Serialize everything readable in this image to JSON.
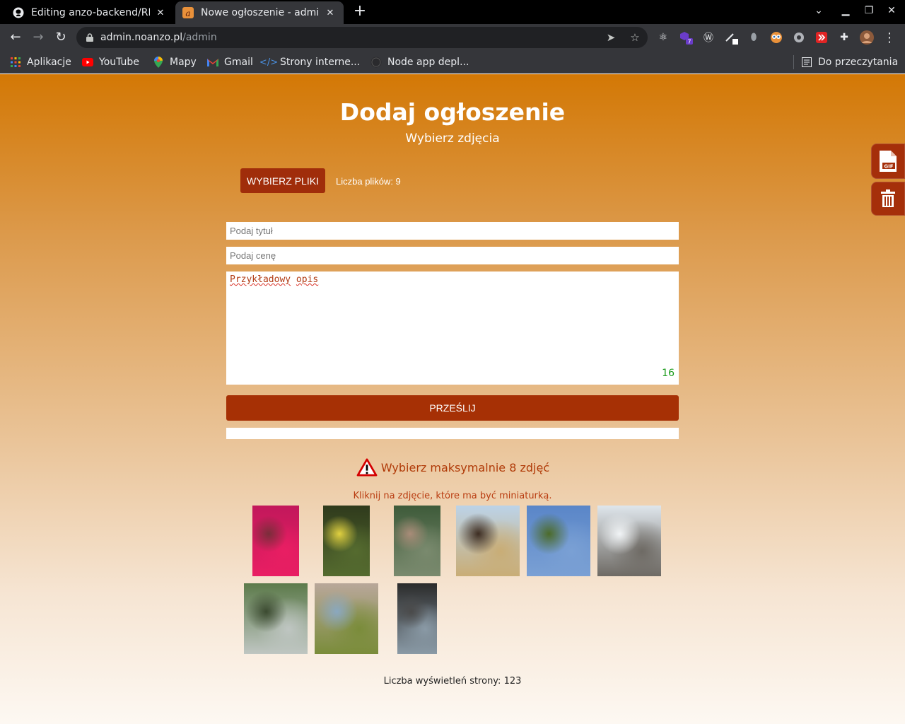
{
  "browser": {
    "tabs": [
      {
        "title": "Editing anzo-backend/RE",
        "active": false
      },
      {
        "title": "Nowe ogłoszenie - admin.",
        "active": true
      }
    ],
    "url_host": "admin.noanzo.pl",
    "url_path": "/admin",
    "extension_badge": "7",
    "bookmarks": [
      {
        "label": "Aplikacje",
        "icon": "apps-grid-icon"
      },
      {
        "label": "YouTube",
        "icon": "youtube-icon"
      },
      {
        "label": "Mapy",
        "icon": "maps-pin-icon"
      },
      {
        "label": "Gmail",
        "icon": "gmail-icon"
      },
      {
        "label": "Strony interne...",
        "icon": "code-icon"
      },
      {
        "label": "Node app depl...",
        "icon": "github-icon"
      }
    ],
    "reading_list": "Do przeczytania"
  },
  "form": {
    "heading": "Dodaj ogłoszenie",
    "subheading": "Wybierz zdjęcia",
    "choose_files": "WYBIERZ PLIKI",
    "file_count": "Liczba plików: 9",
    "title_placeholder": "Podaj tytuł",
    "price_placeholder": "Podaj cenę",
    "description_words": [
      "Przykładowy",
      "opis"
    ],
    "char_count": "16",
    "submit": "PRZEŚLIJ",
    "upload_progress": 0
  },
  "warning": "Wybierz maksymalnie 8 zdjęć",
  "thumbnail_hint": "Kliknij na zdjęcie, które ma być miniaturką.",
  "images": [
    {
      "subject": "pink bougainvillea flowers",
      "colors": [
        "#c2185b",
        "#e91e63",
        "#7a2d3a"
      ]
    },
    {
      "subject": "yellow flower bud",
      "colors": [
        "#2f3a1c",
        "#556b2f",
        "#e0d040"
      ]
    },
    {
      "subject": "mossy stone",
      "colors": [
        "#3e5b3a",
        "#7a8a6e",
        "#a88c78"
      ]
    },
    {
      "subject": "horse near ruins",
      "colors": [
        "#bcd3e8",
        "#c9ad76",
        "#3d2d22"
      ]
    },
    {
      "subject": "lake with reeds",
      "colors": [
        "#5a86c8",
        "#7aa0d4",
        "#4c6b2a"
      ]
    },
    {
      "subject": "snowy forest path",
      "colors": [
        "#dfe6ec",
        "#6e6a64",
        "#f1f4f6"
      ]
    },
    {
      "subject": "waterfall over rock",
      "colors": [
        "#5c7a4a",
        "#bfc6c2",
        "#3b4a30"
      ]
    },
    {
      "subject": "mountain stream",
      "colors": [
        "#b9a79a",
        "#7a8c3a",
        "#8aa8c0"
      ]
    },
    {
      "subject": "dark tower",
      "colors": [
        "#2b2b2b",
        "#8a9aa6",
        "#4a4a4a"
      ]
    }
  ],
  "footer": "Liczba wyświetleń strony: 123"
}
